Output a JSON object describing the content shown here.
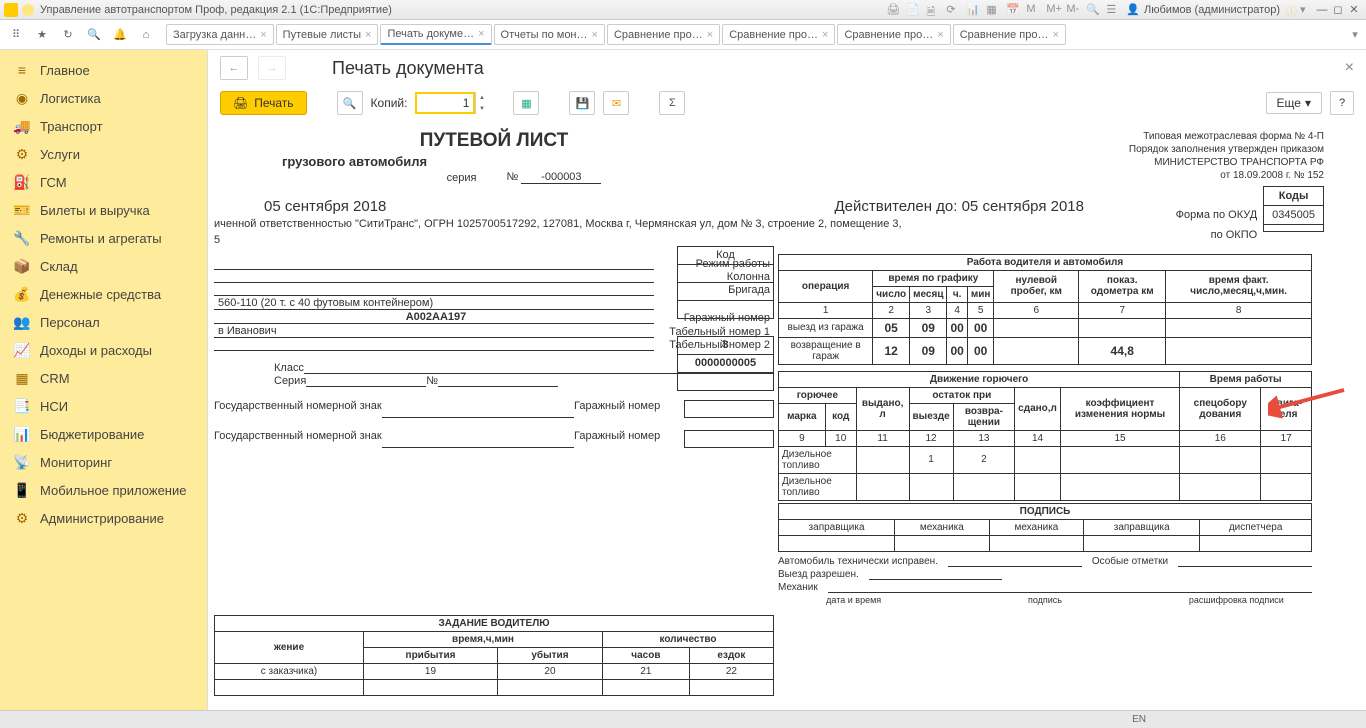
{
  "titlebar": {
    "title": "Управление автотранспортом Проф, редакция 2.1  (1С:Предприятие)",
    "user": "Любимов (администратор)"
  },
  "tabs": [
    "Загрузка данн…",
    "Путевые листы",
    "Печать докуме…",
    "Отчеты по мон…",
    "Сравнение про…",
    "Сравнение про…",
    "Сравнение про…",
    "Сравнение про…"
  ],
  "tabs_active_index": 2,
  "sidebar": {
    "items": [
      "Главное",
      "Логистика",
      "Транспорт",
      "Услуги",
      "ГСМ",
      "Билеты и выручка",
      "Ремонты и агрегаты",
      "Склад",
      "Денежные средства",
      "Персонал",
      "Доходы и расходы",
      "CRM",
      "НСИ",
      "Бюджетирование",
      "Мониторинг",
      "Мобильное приложение",
      "Администрирование"
    ]
  },
  "page": {
    "title": "Печать документа"
  },
  "doc_toolbar": {
    "print": "Печать",
    "copies_label": "Копий:",
    "copies_value": "1",
    "more": "Еще"
  },
  "doc": {
    "title": "ПУТЕВОЙ ЛИСТ",
    "subtitle": "грузового автомобиля",
    "series_lbl": "серия",
    "no_lbl": "№",
    "no_val": "-000003",
    "form_note1": "Типовая межотраслевая форма № 4-П",
    "form_note2": "Порядок заполнения утвержден приказом",
    "form_note3": "МИНИСТЕРСТВО ТРАНСПОРТА РФ",
    "form_note4": "от 18.09.2008 г. № 152",
    "date": "05 сентября 2018",
    "valid_lbl": "Действителен до:",
    "valid_val": "05 сентября 2018",
    "org": "иченной ответственностью  \"СитиТранс\", ОГРН 1025700517292, 127081, Москва г, Чермянская ул, дом № 3, строение 2, помещение 3,",
    "org2": "5",
    "codes": {
      "hdr": "Коды",
      "okud_lbl": "Форма по ОКУД",
      "okud_val": "0345005",
      "okpo_lbl": "по ОКПО",
      "okpo_val": ""
    },
    "ml": {
      "truck": "560-110 (20 т. с 40 футовым контейнером)",
      "plate": "А002АА197",
      "driver": "в Иванович",
      "class_lbl": "Класс",
      "series_lbl": "Серия",
      "no_lbl": "№",
      "gos1": "Государственный номерной знак",
      "gos2": "Государственный номерной знак",
      "garage_lbl": "Гаражный номер",
      "mode_lbl": "Режим работы",
      "col_lbl": "Колонна",
      "brig_lbl": "Бригада",
      "garage_no_lbl": "Гаражный номер",
      "tab1_lbl": "Табельный номер 1",
      "tab2_lbl": "Табельный номер 2",
      "code_lbl": "Код",
      "garage_no_val": "3",
      "tab1_val": "0000000005"
    },
    "work": {
      "hdr": "Работа водителя и автомобиля",
      "op": "операция",
      "sched": "время по графику",
      "nul": "нулевой пробег, км",
      "odo": "показ. одометра км",
      "fact": "время факт. число,месяц,ч,мин.",
      "num": "число",
      "mon": "месяц",
      "h": "ч.",
      "min": "мин",
      "c": [
        "1",
        "2",
        "3",
        "4",
        "5",
        "6",
        "7",
        "8"
      ],
      "out": "выезд из гаража",
      "out_v": [
        "05",
        "09",
        "00",
        "00",
        "",
        "",
        ""
      ],
      "in": "возвращение в гараж",
      "in_v": [
        "12",
        "09",
        "00",
        "00",
        "",
        "44,8",
        ""
      ]
    },
    "fuel": {
      "hdr": "Движение горючего",
      "time_hdr": "Время работы",
      "cols": [
        "горючее",
        "выдано, л",
        "остаток при",
        "сдано,л",
        "коэффициент изменения нормы",
        "спецобору дования",
        "двига- теля"
      ],
      "sub1": "марка",
      "sub2": "код",
      "sub3": "выезде",
      "sub4": "возвра- щении",
      "nums": [
        "9",
        "10",
        "11",
        "12",
        "13",
        "14",
        "15",
        "16",
        "17"
      ],
      "r1": "Дизельное топливо",
      "r1v": [
        "",
        "1",
        "2",
        "",
        "",
        ""
      ],
      "r2": "Дизельное топливо"
    },
    "sign": {
      "hdr": "ПОДПИСЬ",
      "c": [
        "заправщика",
        "механика",
        "механика",
        "заправщика",
        "диспетчера"
      ]
    },
    "task": {
      "hdr": "ЗАДАНИЕ ВОДИТЕЛЮ",
      "trip": "жение",
      "cust": "с заказчика)",
      "time": "время,ч,мин",
      "qty": "количество",
      "arr": "прибытия",
      "dep": "убытия",
      "hrs": "часов",
      "rides": "ездок",
      "nums": [
        "19",
        "20",
        "21",
        "22"
      ]
    },
    "bottom": {
      "l1": "Автомобиль технически исправен.",
      "l2": "Особые отметки",
      "l3": "Выезд разрешен.",
      "l4": "Механик",
      "l5": "дата и время",
      "l6": "подпись",
      "l7": "расшифровка подписи"
    }
  },
  "statusbar": {
    "lang": "EN"
  }
}
